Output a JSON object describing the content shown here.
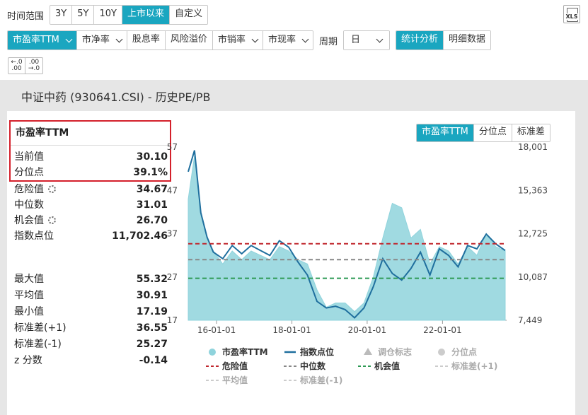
{
  "toolbar": {
    "range_label": "时间范围",
    "range_options": [
      "3Y",
      "5Y",
      "10Y",
      "上市以来",
      "自定义"
    ],
    "range_selected": "上市以来",
    "metrics": [
      {
        "label": "市盈率TTM",
        "dropdown": true,
        "active": true
      },
      {
        "label": "市净率",
        "dropdown": true,
        "active": false
      },
      {
        "label": "股息率",
        "dropdown": false,
        "active": false
      },
      {
        "label": "风险溢价",
        "dropdown": false,
        "active": false
      },
      {
        "label": "市销率",
        "dropdown": true,
        "active": false
      },
      {
        "label": "市现率",
        "dropdown": true,
        "active": false
      }
    ],
    "period_label": "周期",
    "period_value": "日",
    "view_tabs": [
      "统计分析",
      "明细数据"
    ],
    "view_selected": "统计分析",
    "export_label": "XLS",
    "decimal_buttons": [
      ".0 .00",
      ".00 .0"
    ]
  },
  "section_title": "中证中药 (930641.CSI) - 历史PE/PB",
  "stats": {
    "title": "市盈率TTM",
    "current_label": "当前值",
    "current_value": "30.10",
    "percentile_label": "分位点",
    "percentile_value": "39.1%",
    "danger_label": "危险值",
    "danger_value": "34.67",
    "median_label": "中位数",
    "median_value": "31.01",
    "opportunity_label": "机会值",
    "opportunity_value": "26.70",
    "index_label": "指数点位",
    "index_value": "11,702.46",
    "max_label": "最大值",
    "max_value": "55.32",
    "avg_label": "平均值",
    "avg_value": "30.91",
    "min_label": "最小值",
    "min_value": "17.19",
    "std_plus_label": "标准差(+1)",
    "std_plus_value": "36.55",
    "std_minus_label": "标准差(-1)",
    "std_minus_value": "25.27",
    "z_label": "z 分数",
    "z_value": "-0.14"
  },
  "chart_tabs": [
    "市盈率TTM",
    "分位点",
    "标准差"
  ],
  "chart_tab_selected": "市盈率TTM",
  "colors": {
    "accent": "#1aa6c0",
    "pe_area": "#8fd3dc",
    "index_line": "#1f6f9e",
    "danger": "#c0262d",
    "median": "#888888",
    "opportunity": "#2e9a55",
    "highlight": "#d4202b"
  },
  "chart_data": {
    "type": "line",
    "x": [
      "2015-04",
      "2015-06",
      "2015-08",
      "2015-10",
      "2015-12",
      "2016-03",
      "2016-06",
      "2016-09",
      "2016-12",
      "2017-03",
      "2017-06",
      "2017-09",
      "2017-12",
      "2018-03",
      "2018-06",
      "2018-09",
      "2018-12",
      "2019-03",
      "2019-06",
      "2019-09",
      "2019-12",
      "2020-03",
      "2020-06",
      "2020-09",
      "2020-12",
      "2021-03",
      "2021-06",
      "2021-09",
      "2021-12",
      "2022-03",
      "2022-06",
      "2022-09",
      "2022-12",
      "2023-03",
      "2023-06",
      "2023-09"
    ],
    "series": [
      {
        "name": "市盈率TTM",
        "axis": "left",
        "values": [
          45,
          55,
          42,
          36,
          33,
          30,
          33,
          31,
          33,
          32,
          31,
          34,
          33,
          31,
          30,
          24,
          20,
          21,
          21,
          19,
          21,
          27,
          36,
          44,
          43,
          36,
          38,
          30,
          34,
          33,
          30,
          34,
          32,
          37,
          34,
          33
        ]
      },
      {
        "name": "指数点位",
        "axis": "right",
        "values": [
          16500,
          17800,
          14000,
          12500,
          11600,
          11200,
          12000,
          11500,
          12000,
          11700,
          11400,
          12300,
          11900,
          11000,
          10200,
          8600,
          8200,
          8300,
          8100,
          7600,
          8200,
          9500,
          11200,
          10300,
          9900,
          10600,
          11600,
          10200,
          11800,
          11400,
          10700,
          12000,
          11800,
          12700,
          12100,
          11700
        ]
      }
    ],
    "reference_lines": [
      {
        "name": "危险值",
        "value": 34.67,
        "axis": "left"
      },
      {
        "name": "中位数",
        "value": 31.01,
        "axis": "left"
      },
      {
        "name": "机会值",
        "value": 26.7,
        "axis": "left"
      }
    ],
    "y_left_ticks": [
      "57",
      "47",
      "37",
      "27",
      "17"
    ],
    "y_left_range": [
      17,
      57
    ],
    "y_right_ticks": [
      "18,001",
      "15,363",
      "12,725",
      "10,087",
      "7,449"
    ],
    "y_right_range": [
      7449,
      18001
    ],
    "x_ticks": [
      "16-01-01",
      "18-01-01",
      "20-01-01",
      "22-01-01"
    ],
    "legend": [
      "市盈率TTM",
      "指数点位",
      "调仓标志",
      "分位点",
      "危险值",
      "中位数",
      "机会值",
      "标准差(+1)",
      "平均值",
      "标准差(-1)"
    ],
    "legend_disabled": [
      "调仓标志",
      "分位点",
      "标准差(+1)",
      "平均值",
      "标准差(-1)"
    ]
  }
}
